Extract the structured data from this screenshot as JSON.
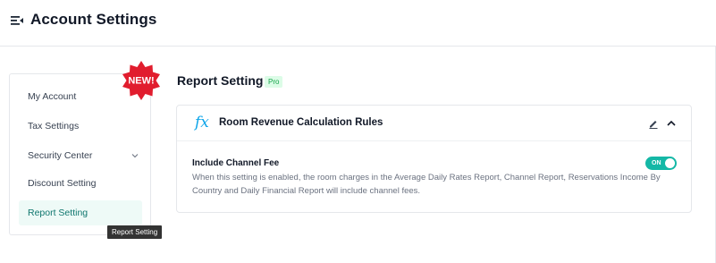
{
  "header": {
    "title": "Account Settings",
    "menu_icon": "menu-collapse-icon"
  },
  "sidebar": {
    "items": [
      {
        "label": "My Account"
      },
      {
        "label": "Tax Settings"
      },
      {
        "label": "Security Center",
        "icon": "chevron-down-icon"
      },
      {
        "label": "Discount Setting"
      },
      {
        "label": "Report Setting",
        "active": true
      }
    ],
    "new_badge": "NEW!",
    "tooltip": "Report Setting"
  },
  "main": {
    "section_title": "Report Setting",
    "pro_badge": "Pro",
    "card": {
      "icon_text": "fx",
      "title": "Room Revenue Calculation Rules",
      "setting": {
        "label": "Include Channel Fee",
        "description": "When this setting is enabled, the room charges in the Average Daily Rates Report, Channel Report, Reservations Income By Country and Daily Financial Report will include channel fees.",
        "toggle_text": "ON",
        "enabled": true
      }
    }
  },
  "colors": {
    "accent": "#14b8a6",
    "badge_red": "#e11d2e",
    "pro_green": "#16a34a"
  }
}
